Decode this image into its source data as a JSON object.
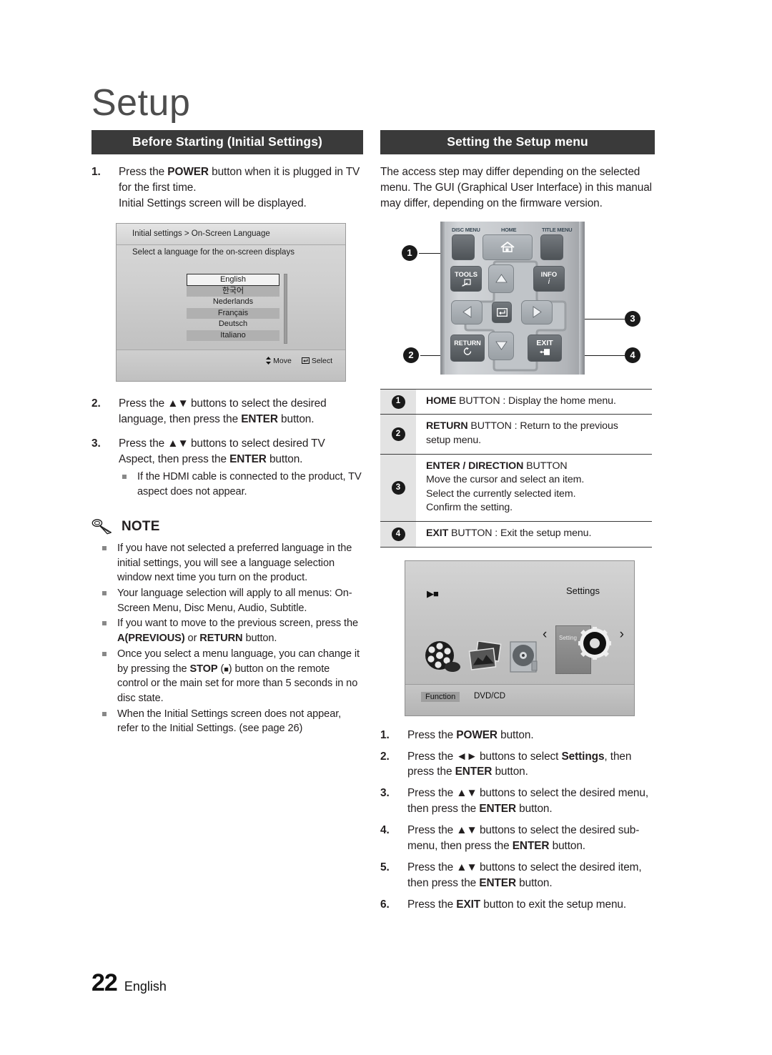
{
  "page": {
    "chapter_title": "Setup",
    "page_number": "22",
    "language": "English"
  },
  "left_column": {
    "section_title": "Before Starting (Initial Settings)",
    "steps": [
      {
        "num": "1.",
        "lines": [
          "Press the POWER button when it is plugged in",
          "TV for the first time.",
          "Initial Settings screen will be displayed."
        ],
        "bold_terms": [
          "POWER"
        ]
      },
      {
        "num": "2.",
        "lines": [
          "Press the ▲▼ buttons to select the desired",
          "language, then press the ENTER button."
        ],
        "bold_terms": [
          "ENTER"
        ]
      },
      {
        "num": "3.",
        "lines": [
          "Press the ▲▼ buttons to select desired TV Aspect,",
          "then press the ENTER button."
        ],
        "bold_terms": [
          "ENTER"
        ],
        "sub_bullets": [
          "If the HDMI cable is connected to the product, TV aspect does not appear."
        ]
      }
    ],
    "language_screen": {
      "breadcrumb": "Initial settings > On-Screen Language",
      "subtitle": "Select a language for the on-screen displays",
      "options": [
        {
          "label": "English",
          "selected": true
        },
        {
          "label": "한국어",
          "selected": false
        },
        {
          "label": "Nederlands",
          "selected": false
        },
        {
          "label": "Français",
          "selected": false
        },
        {
          "label": "Deutsch",
          "selected": false
        },
        {
          "label": "Italiano",
          "selected": false
        }
      ],
      "footer_move": "Move",
      "footer_select": "Select"
    },
    "note": {
      "label": "NOTE",
      "bullets": [
        "If you have not selected a preferred language in the initial settings, you will see a language selection window next time you turn on the product.",
        "Your language selection will apply to all menus: On-Screen Menu, Disc Menu, Audio, Subtitle.",
        "If you want to move to the previous screen, press the A(PREVIOUS) or RETURN button.",
        "Once you select a menu language, you can change it by pressing the STOP (■) button on the remote control or the main set  for more than 5 seconds in no disc state.",
        "When the Initial Settings screen does not appear, refer to the Initial Settings. (see page 26)"
      ]
    }
  },
  "right_column": {
    "section_title": "Setting the Setup menu",
    "intro": "The access step may differ depending on the selected menu. The GUI (Graphical User Interface) in this manual may differ, depending on the firmware version.",
    "remote": {
      "labels": {
        "disc_menu": "DISC MENU",
        "home": "HOME",
        "title_menu": "TITLE MENU",
        "tools": "TOOLS",
        "info": "INFO",
        "return": "RETURN",
        "exit": "EXIT"
      },
      "callouts": [
        "1",
        "2",
        "3",
        "4"
      ]
    },
    "button_table": [
      {
        "num": "1",
        "bold": "HOME",
        "rest": " BUTTON : Display the home menu.",
        "extra_lines": []
      },
      {
        "num": "2",
        "bold": "RETURN",
        "rest": " BUTTON : Return to the previous",
        "extra_lines": [
          "setup menu."
        ]
      },
      {
        "num": "3",
        "bold": "ENTER / DIRECTION",
        "rest": " BUTTON",
        "extra_lines": [
          "Move the cursor and select an item.",
          "Select the currently selected item.",
          "Confirm the setting."
        ]
      },
      {
        "num": "4",
        "bold": "EXIT",
        "rest": " BUTTON : Exit the setup menu.",
        "extra_lines": []
      }
    ],
    "home_screen": {
      "settings_label": "Settings",
      "settings_card_caption": "Setting",
      "function_label": "Function",
      "source_label": "DVD/CD",
      "arrow_left": "‹",
      "arrow_right": "›"
    },
    "steps": [
      {
        "num": "1.",
        "lines": [
          "Press the POWER button."
        ]
      },
      {
        "num": "2.",
        "lines": [
          "Press the ◄► buttons to select Settings, then",
          "press the ENTER button."
        ]
      },
      {
        "num": "3.",
        "lines": [
          "Press the ▲▼ buttons to select the desired",
          "menu, then press the ENTER button."
        ]
      },
      {
        "num": "4.",
        "lines": [
          "Press the ▲▼ buttons to select the desired",
          "sub-menu, then press the ENTER button."
        ]
      },
      {
        "num": "5.",
        "lines": [
          "Press the ▲▼ buttons to select the desired",
          "item, then press the ENTER button."
        ]
      },
      {
        "num": "6.",
        "lines": [
          "Press the EXIT button to exit the setup menu."
        ]
      }
    ]
  },
  "colors": {
    "header_bar": "#3a3a3a",
    "text": "#231f20",
    "bullet": "#888888",
    "table_rule": "#3a3a3a",
    "badge_cell": "#e3e3e3"
  }
}
